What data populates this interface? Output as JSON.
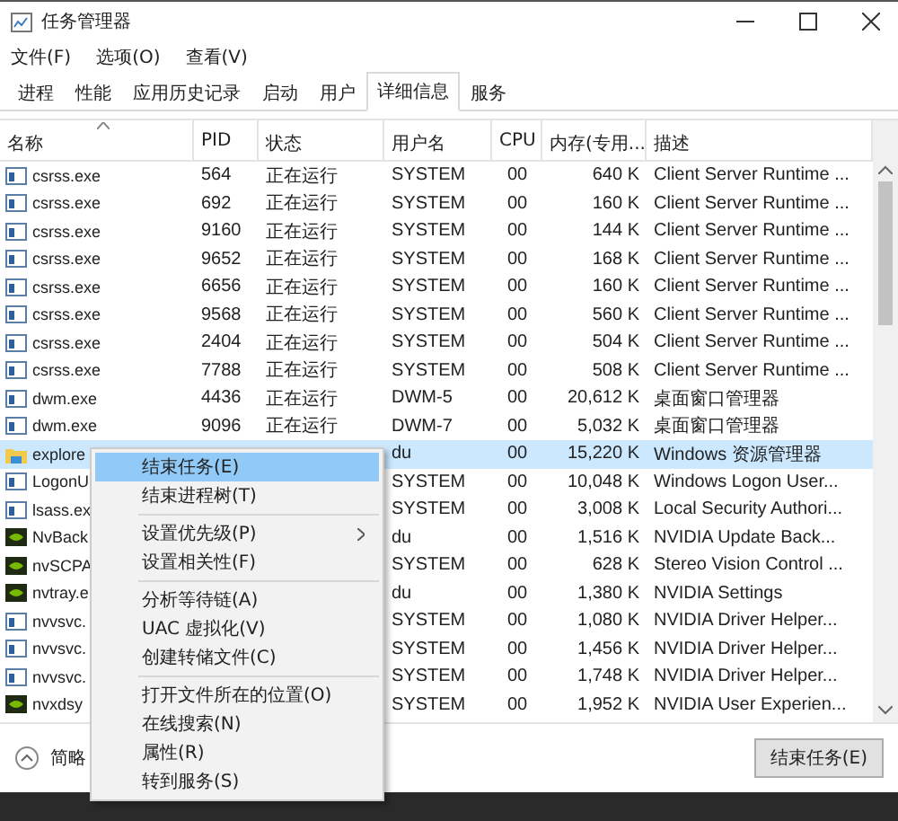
{
  "window": {
    "title": "任务管理器"
  },
  "menu_bar": [
    "文件(F)",
    "选项(O)",
    "查看(V)"
  ],
  "tabs": [
    {
      "label": "进程",
      "selected": false
    },
    {
      "label": "性能",
      "selected": false
    },
    {
      "label": "应用历史记录",
      "selected": false
    },
    {
      "label": "启动",
      "selected": false
    },
    {
      "label": "用户",
      "selected": false
    },
    {
      "label": "详细信息",
      "selected": true
    },
    {
      "label": "服务",
      "selected": false
    }
  ],
  "table": {
    "columns": [
      "名称",
      "PID",
      "状态",
      "用户名",
      "CPU",
      "内存(专用...",
      "描述"
    ],
    "rows": [
      {
        "kind": "app",
        "name": "csrss.exe",
        "pid": "564",
        "status": "正在运行",
        "user": "SYSTEM",
        "cpu": "00",
        "memory": "640 K",
        "description": "Client Server Runtime ...",
        "selected": false
      },
      {
        "kind": "app",
        "name": "csrss.exe",
        "pid": "692",
        "status": "正在运行",
        "user": "SYSTEM",
        "cpu": "00",
        "memory": "160 K",
        "description": "Client Server Runtime ...",
        "selected": false
      },
      {
        "kind": "app",
        "name": "csrss.exe",
        "pid": "9160",
        "status": "正在运行",
        "user": "SYSTEM",
        "cpu": "00",
        "memory": "144 K",
        "description": "Client Server Runtime ...",
        "selected": false
      },
      {
        "kind": "app",
        "name": "csrss.exe",
        "pid": "9652",
        "status": "正在运行",
        "user": "SYSTEM",
        "cpu": "00",
        "memory": "168 K",
        "description": "Client Server Runtime ...",
        "selected": false
      },
      {
        "kind": "app",
        "name": "csrss.exe",
        "pid": "6656",
        "status": "正在运行",
        "user": "SYSTEM",
        "cpu": "00",
        "memory": "160 K",
        "description": "Client Server Runtime ...",
        "selected": false
      },
      {
        "kind": "app",
        "name": "csrss.exe",
        "pid": "9568",
        "status": "正在运行",
        "user": "SYSTEM",
        "cpu": "00",
        "memory": "560 K",
        "description": "Client Server Runtime ...",
        "selected": false
      },
      {
        "kind": "app",
        "name": "csrss.exe",
        "pid": "2404",
        "status": "正在运行",
        "user": "SYSTEM",
        "cpu": "00",
        "memory": "504 K",
        "description": "Client Server Runtime ...",
        "selected": false
      },
      {
        "kind": "app",
        "name": "csrss.exe",
        "pid": "7788",
        "status": "正在运行",
        "user": "SYSTEM",
        "cpu": "00",
        "memory": "508 K",
        "description": "Client Server Runtime ...",
        "selected": false
      },
      {
        "kind": "app",
        "name": "dwm.exe",
        "pid": "4436",
        "status": "正在运行",
        "user": "DWM-5",
        "cpu": "00",
        "memory": "20,612 K",
        "description": "桌面窗口管理器",
        "selected": false
      },
      {
        "kind": "app",
        "name": "dwm.exe",
        "pid": "9096",
        "status": "正在运行",
        "user": "DWM-7",
        "cpu": "00",
        "memory": "5,032 K",
        "description": "桌面窗口管理器",
        "selected": false
      },
      {
        "kind": "folder",
        "name": "explore",
        "user": "du",
        "cpu": "00",
        "memory": "15,220 K",
        "description": "Windows 资源管理器",
        "selected": true
      },
      {
        "kind": "app",
        "name": "LogonU",
        "user": "SYSTEM",
        "cpu": "00",
        "memory": "10,048 K",
        "description": "Windows Logon User...",
        "selected": false
      },
      {
        "kind": "app",
        "name": "lsass.ex",
        "user": "SYSTEM",
        "cpu": "00",
        "memory": "3,008 K",
        "description": "Local Security Authori...",
        "selected": false
      },
      {
        "kind": "nvidia",
        "name": "NvBack",
        "user": "du",
        "cpu": "00",
        "memory": "1,516 K",
        "description": "NVIDIA Update Back...",
        "selected": false
      },
      {
        "kind": "nvidia",
        "name": "nvSCPA",
        "user": "SYSTEM",
        "cpu": "00",
        "memory": "628 K",
        "description": "Stereo Vision Control ...",
        "selected": false
      },
      {
        "kind": "nvidia",
        "name": "nvtray.e",
        "user": "du",
        "cpu": "00",
        "memory": "1,380 K",
        "description": "NVIDIA Settings",
        "selected": false
      },
      {
        "kind": "app",
        "name": "nvvsvc.",
        "user": "SYSTEM",
        "cpu": "00",
        "memory": "1,080 K",
        "description": "NVIDIA Driver Helper...",
        "selected": false
      },
      {
        "kind": "app",
        "name": "nvvsvc.",
        "user": "SYSTEM",
        "cpu": "00",
        "memory": "1,456 K",
        "description": "NVIDIA Driver Helper...",
        "selected": false
      },
      {
        "kind": "app",
        "name": "nvvsvc.",
        "user": "SYSTEM",
        "cpu": "00",
        "memory": "1,748 K",
        "description": "NVIDIA Driver Helper...",
        "selected": false
      },
      {
        "kind": "nvidia",
        "name": "nvxdsy",
        "user": "SYSTEM",
        "cpu": "00",
        "memory": "1,952 K",
        "description": "NVIDIA User Experien...",
        "selected": false
      }
    ]
  },
  "context_menu": {
    "items": [
      {
        "label": "结束任务(E)",
        "highlighted": true,
        "submenu": false,
        "separator_before": false
      },
      {
        "label": "结束进程树(T)",
        "highlighted": false,
        "submenu": false,
        "separator_before": false
      },
      {
        "label": "设置优先级(P)",
        "highlighted": false,
        "submenu": true,
        "separator_before": true
      },
      {
        "label": "设置相关性(F)",
        "highlighted": false,
        "submenu": false,
        "separator_before": false
      },
      {
        "label": "分析等待链(A)",
        "highlighted": false,
        "submenu": false,
        "separator_before": true
      },
      {
        "label": "UAC 虚拟化(V)",
        "highlighted": false,
        "submenu": false,
        "separator_before": false
      },
      {
        "label": "创建转储文件(C)",
        "highlighted": false,
        "submenu": false,
        "separator_before": false
      },
      {
        "label": "打开文件所在的位置(O)",
        "highlighted": false,
        "submenu": false,
        "separator_before": true
      },
      {
        "label": "在线搜索(N)",
        "highlighted": false,
        "submenu": false,
        "separator_before": false
      },
      {
        "label": "属性(R)",
        "highlighted": false,
        "submenu": false,
        "separator_before": false
      },
      {
        "label": "转到服务(S)",
        "highlighted": false,
        "submenu": false,
        "separator_before": false
      }
    ]
  },
  "footer": {
    "details_toggle": "简略",
    "end_task_button": "结束任务(E)"
  }
}
